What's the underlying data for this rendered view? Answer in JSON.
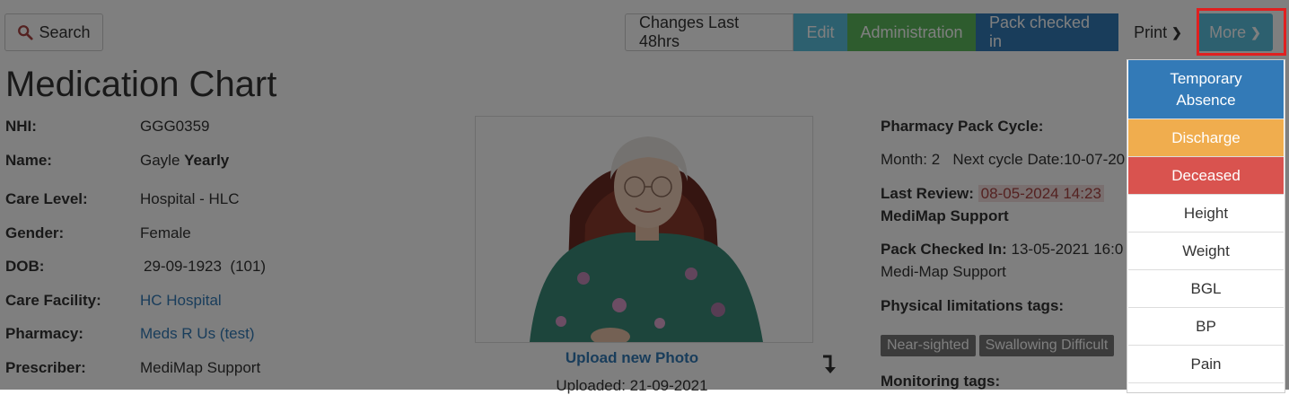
{
  "toolbar": {
    "search_label": "Search",
    "changes_label": "Changes Last 48hrs",
    "edit_label": "Edit",
    "admin_label": "Administration",
    "pack_label": "Pack checked in",
    "print_label": "Print",
    "more_label": "More"
  },
  "page_title": "Medication Chart",
  "patient": {
    "nhi_label": "NHI:",
    "nhi": "GGG0359",
    "name_label": "Name:",
    "first_name": "Gayle",
    "last_name": "Yearly",
    "care_level_label": "Care Level:",
    "care_level": "Hospital - HLC",
    "gender_label": "Gender:",
    "gender": "Female",
    "dob_label": "DOB:",
    "dob": "29-09-1923  (101)",
    "facility_label": "Care Facility:",
    "facility": "HC Hospital",
    "pharmacy_label": "Pharmacy:",
    "pharmacy": "Meds R Us (test)",
    "prescriber_label": "Prescriber:",
    "prescriber": "MediMap Support"
  },
  "photo": {
    "upload_label": "Upload new Photo",
    "uploaded_text": "Uploaded: 21-09-2021"
  },
  "pharmacy_info": {
    "cycle_label": "Pharmacy Pack Cycle:",
    "cycle_text": "Month: 2   Next cycle Date:10-07-20",
    "last_review_label": "Last Review:",
    "last_review_date": "08-05-2024 14:23",
    "last_review_by": "MediMap Support",
    "pack_checked_label": "Pack Checked In:",
    "pack_checked_date": "13-05-2021 16:0",
    "pack_checked_by": "Medi-Map Support",
    "physical_tags_label": "Physical limitations tags:",
    "physical_tags": [
      "Near-sighted",
      "Swallowing Difficult"
    ],
    "monitoring_label": "Monitoring tags:"
  },
  "more_menu": {
    "items": [
      "Temporary Absence",
      "Discharge",
      "Deceased",
      "Height",
      "Weight",
      "BGL",
      "BP",
      "Pain"
    ]
  },
  "colors": {
    "primary": "#337ab7",
    "info": "#5bc0de",
    "success": "#5cb85c",
    "warning": "#f0ad4e",
    "danger": "#d9534f",
    "highlight": "#e02020"
  }
}
